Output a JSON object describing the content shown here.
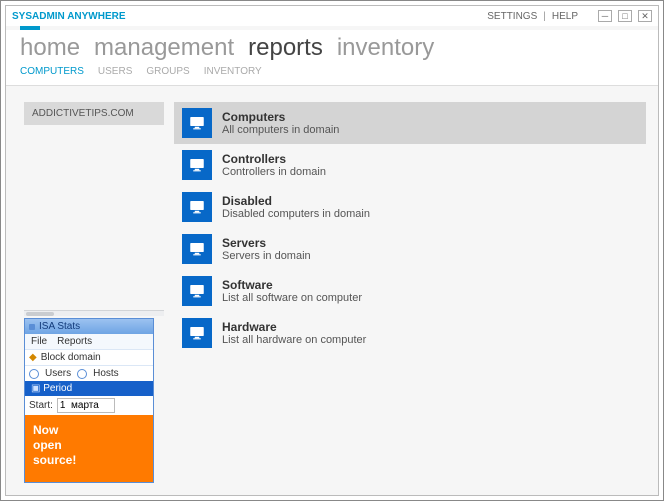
{
  "window": {
    "title": "SYSADMIN ANYWHERE",
    "settings": "SETTINGS",
    "help": "HELP"
  },
  "nav": {
    "items": [
      {
        "label": "home",
        "active": false
      },
      {
        "label": "management",
        "active": false
      },
      {
        "label": "reports",
        "active": true
      },
      {
        "label": "inventory",
        "active": false
      }
    ]
  },
  "subnav": {
    "items": [
      {
        "label": "COMPUTERS",
        "active": true
      },
      {
        "label": "USERS",
        "active": false
      },
      {
        "label": "GROUPS",
        "active": false
      },
      {
        "label": "INVENTORY",
        "active": false
      }
    ]
  },
  "left": {
    "domain": "ADDICTIVETIPS.COM"
  },
  "ad": {
    "header": "ISA Stats",
    "menu": {
      "file": "File",
      "reports": "Reports"
    },
    "block": "Block domain",
    "tabs": {
      "users": "Users",
      "hosts": "Hosts"
    },
    "period": "Period",
    "start_label": "Start:",
    "start_value": "1  марта",
    "banner_l1": "Now",
    "banner_l2": "open",
    "banner_l3": "source!"
  },
  "reports": {
    "items": [
      {
        "title": "Computers",
        "desc": "All computers in domain",
        "selected": true
      },
      {
        "title": "Controllers",
        "desc": "Controllers in domain",
        "selected": false
      },
      {
        "title": "Disabled",
        "desc": "Disabled computers in domain",
        "selected": false
      },
      {
        "title": "Servers",
        "desc": "Servers in domain",
        "selected": false
      },
      {
        "title": "Software",
        "desc": "List all software on computer",
        "selected": false
      },
      {
        "title": "Hardware",
        "desc": "List all hardware on computer",
        "selected": false
      }
    ]
  }
}
